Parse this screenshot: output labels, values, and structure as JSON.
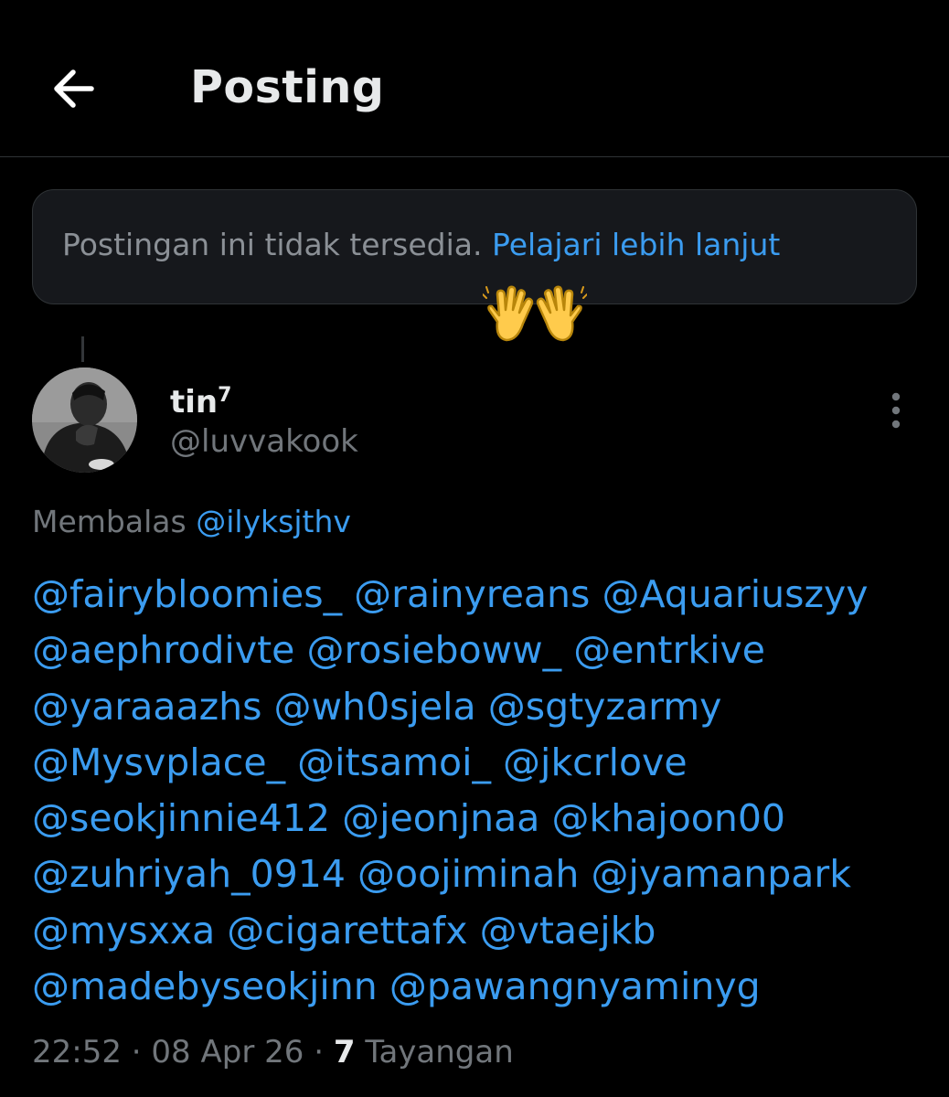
{
  "header": {
    "title": "Posting",
    "back_icon": "arrow-left-icon"
  },
  "notice": {
    "text": "Postingan ini tidak tersedia.",
    "link": "Pelajari lebih lanjut"
  },
  "emoji": "raising-hands-icon",
  "post": {
    "author": {
      "name": "tin",
      "name_sup": "7",
      "handle": "@luvvakook"
    },
    "reply": {
      "prefix": "Membalas",
      "target": "@ilyksjthv"
    },
    "mention_lines": [
      [
        "@fairybloomies_",
        "@rainyreans",
        "@Aquariuszyy"
      ],
      [
        "@aephrodivte",
        "@rosieboww_",
        "@entrkive"
      ],
      [
        "@yaraaazhs",
        "@wh0sjela",
        "@sgtyzarmy"
      ],
      [
        "@Mysvplace_",
        "@itsamoi_",
        "@jkcrlove"
      ],
      [
        "@seokjinnie412",
        "@jeonjnaa",
        "@khajoon00"
      ],
      [
        "@zuhriyah_0914",
        "@oojiminah",
        "@jyamanpark"
      ],
      [
        "@mysxxa",
        "@cigarettafx",
        "@vtaejkb"
      ],
      [
        "@madebyseokjinn",
        "@pawangnyaminyg"
      ]
    ],
    "meta": {
      "time": "22:52",
      "separator": "·",
      "date": "08 Apr 26",
      "views": "7",
      "views_label": "Tayangan"
    }
  },
  "colors": {
    "background": "#000000",
    "text": "#e7e9ea",
    "muted": "#71767b",
    "link": "#3b9cf0",
    "notice_bg": "#16181c",
    "border": "#2f3336"
  }
}
